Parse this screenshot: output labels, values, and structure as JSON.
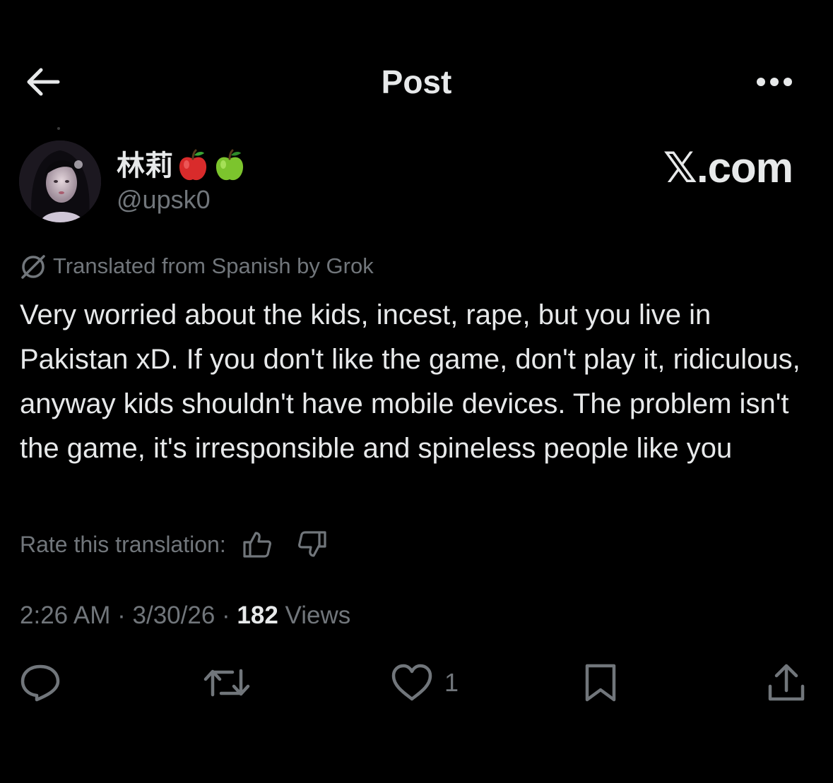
{
  "header": {
    "title": "Post",
    "back_icon": "arrow-left-icon",
    "more_icon": "more-horizontal-icon"
  },
  "author": {
    "display_name": "林莉",
    "emojis": [
      "red-apple-emoji",
      "green-apple-emoji"
    ],
    "handle": "@upsk0"
  },
  "watermark": "𝕏.com",
  "translation": {
    "label": "Translated from Spanish by Grok",
    "icon": "grok-icon"
  },
  "post": {
    "text": "Very worried about the kids, incest, rape, but you live in Pakistan xD. If you don't like the game, don't play it, ridiculous, anyway kids shouldn't have mobile devices. The problem isn't the game, it's irresponsible and spineless people like you"
  },
  "rate": {
    "label": "Rate this translation:",
    "up_icon": "thumbs-up-icon",
    "down_icon": "thumbs-down-icon"
  },
  "meta": {
    "time": "2:26 AM",
    "sep1": " · ",
    "date": "3/30/26",
    "sep2": " · ",
    "views_count": "182",
    "views_label": " Views"
  },
  "actions": {
    "reply_icon": "reply-icon",
    "repost_icon": "repost-icon",
    "like_icon": "heart-icon",
    "like_count": "1",
    "bookmark_icon": "bookmark-icon",
    "share_icon": "share-icon"
  },
  "colors": {
    "background": "#000000",
    "primary_text": "#e7e9ea",
    "secondary_text": "#71767b"
  }
}
